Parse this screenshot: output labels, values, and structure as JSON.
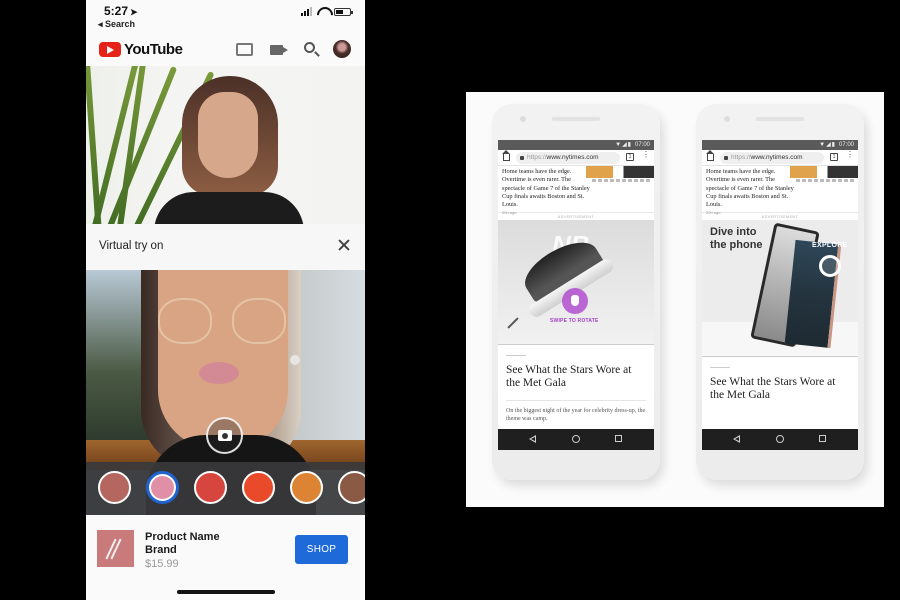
{
  "left_phone": {
    "status_bar": {
      "time": "5:27",
      "location_glyph": "➤",
      "back_label": "◂ Search"
    },
    "header": {
      "app_name": "YouTube",
      "icons": [
        "cast-icon",
        "camera-icon",
        "search-icon",
        "avatar"
      ]
    },
    "try_on": {
      "title": "Virtual try on",
      "close_icon": "close-icon",
      "shutter_icon": "camera-icon",
      "swatches": [
        {
          "name": "mauve-rose",
          "color": "#b5665f",
          "selected": false
        },
        {
          "name": "pink",
          "color": "#e08fa6",
          "selected": true
        },
        {
          "name": "coral-red",
          "color": "#d7453f",
          "selected": false
        },
        {
          "name": "orange-red",
          "color": "#e84a2a",
          "selected": false
        },
        {
          "name": "amber",
          "color": "#dd8434",
          "selected": false
        },
        {
          "name": "bronze",
          "color": "#8a5a44",
          "selected": false
        }
      ],
      "selected_color_accent": "#1e63d0"
    },
    "product": {
      "name": "Product Name",
      "brand": "Brand",
      "price": "$15.99",
      "cta_label": "SHOP",
      "cta_color": "#1f6ad9"
    }
  },
  "right_panel": {
    "phones": [
      {
        "status_time": "07:00",
        "status_symbols": "▼◢▮",
        "url_scheme": "https://",
        "url_host": "www.nytimes.com",
        "tab_count": "1",
        "article_snippet": "Home teams have the edge. Overtime is even rarer. The spectacle of Game 7 of the Stanley Cup finals awaits Boston and St. Louis.",
        "article_age": "20h ago",
        "ad_label": "Advertisement",
        "ad": {
          "type": "shoe",
          "brand_mark": "NB",
          "cta": "SWIPE TO ROTATE",
          "accent": "#a240c9"
        },
        "headline": "See What the Stars Wore at the Met Gala",
        "dek": "On the biggest night of the year for celebrity dress-up, the theme was camp."
      },
      {
        "status_time": "07:00",
        "status_symbols": "▼◢▮",
        "url_scheme": "https://",
        "url_host": "www.nytimes.com",
        "tab_count": "1",
        "article_snippet": "Home teams have the edge. Overtime is even rarer. The spectacle of Game 7 of the Stanley Cup finals awaits Boston and St. Louis.",
        "article_age": "20h ago",
        "ad_label": "Advertisement",
        "ad": {
          "type": "pixel",
          "title": "Dive into the phone",
          "cta": "EXPLORE"
        },
        "headline": "See What the Stars Wore at the Met Gala"
      }
    ]
  }
}
